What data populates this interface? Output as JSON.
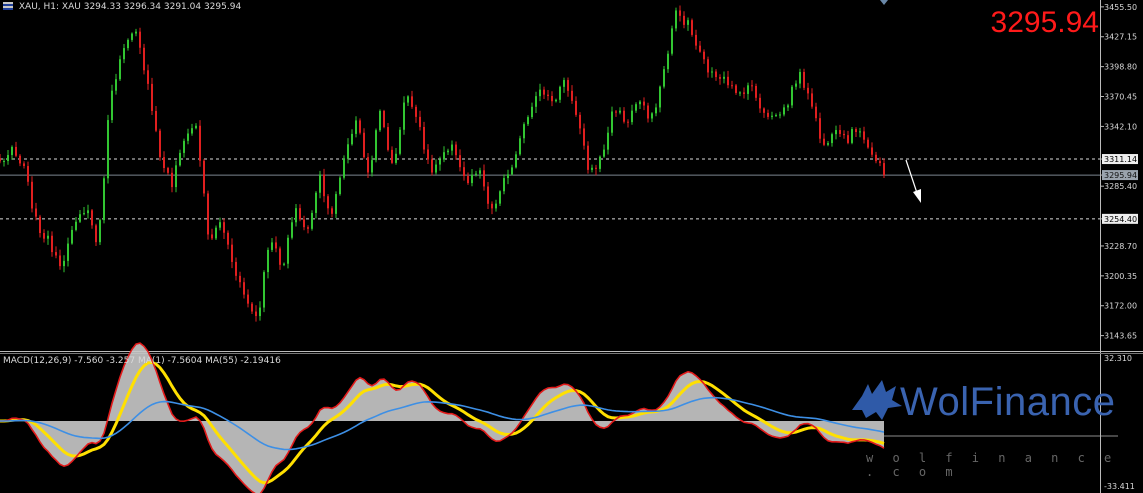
{
  "header": {
    "symbol": "XAU, H1:",
    "description": "XAU",
    "ohlc": "3294.33 3296.34 3291.04 3295.94"
  },
  "big_price": "3295.94",
  "price_labels": [
    "3455.50",
    "3427.15",
    "3398.80",
    "3370.45",
    "3342.10",
    "3311.14",
    "3295.94",
    "3285.40",
    "3254.40",
    "3228.70",
    "3200.35",
    "3172.00",
    "3143.65"
  ],
  "macd": {
    "header": "MACD(12,26,9) -7.560 -3.257 MA(1) -7.5604 MA(55) -2.19416",
    "scale_top": "32.310",
    "scale_bottom": "-33.411"
  },
  "watermark": {
    "brand": "WolFinance",
    "site": "w o l f i n a n c e . c o m"
  },
  "colors": {
    "bull": "#32c632",
    "bear": "#e01f1f",
    "macd_line": "#e21b1b",
    "macd_fill": "#c9c9c9",
    "signal_yellow": "#ffe000",
    "ma55_blue": "#3d8fe5",
    "big_price": "#ff1a1a"
  },
  "chart_data": {
    "type": "candlestick",
    "symbol": "XAU",
    "timeframe": "H1",
    "ylim": [
      3130,
      3462
    ],
    "levels": [
      3311.14,
      3254.4
    ],
    "last_price": 3295.94,
    "anchors": [
      3308,
      3318,
      3300,
      3248,
      3232,
      3212,
      3244,
      3268,
      3228,
      3375,
      3412,
      3432,
      3388,
      3315,
      3286,
      3332,
      3344,
      3232,
      3252,
      3212,
      3178,
      3160,
      3242,
      3202,
      3268,
      3238,
      3298,
      3254,
      3312,
      3350,
      3296,
      3358,
      3300,
      3372,
      3354,
      3298,
      3312,
      3322,
      3288,
      3300,
      3258,
      3288,
      3312,
      3354,
      3382,
      3362,
      3390,
      3348,
      3298,
      3312,
      3362,
      3345,
      3368,
      3345,
      3390,
      3450,
      3440,
      3410,
      3390,
      3392,
      3370,
      3383,
      3360,
      3350,
      3360,
      3392,
      3372,
      3320,
      3345,
      3330,
      3342,
      3316,
      3296
    ]
  }
}
